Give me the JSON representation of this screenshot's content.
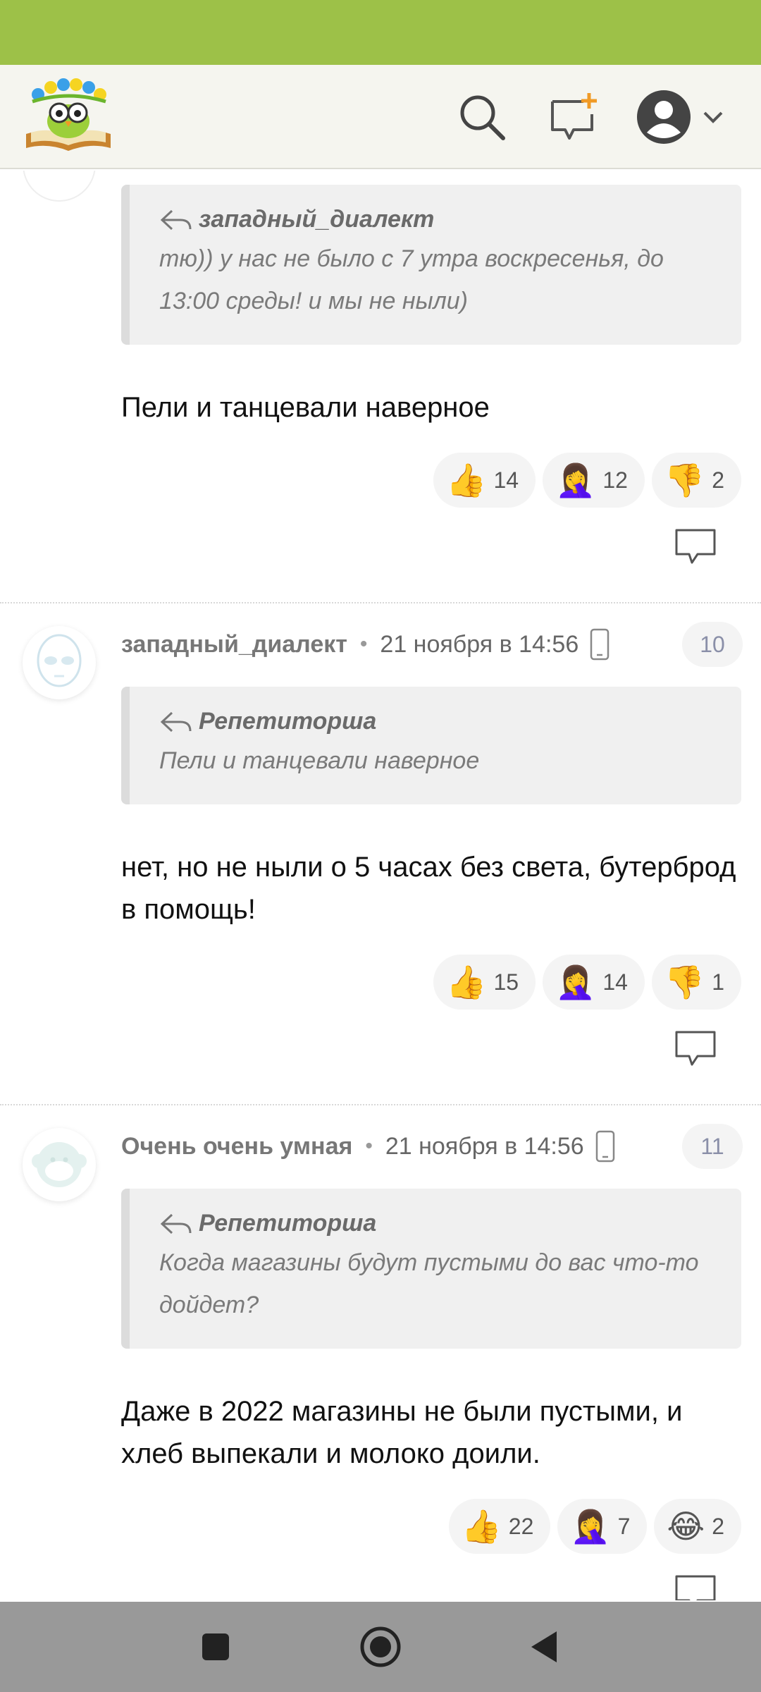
{
  "app": {
    "logo_icon": "owl-on-book-logo",
    "header_icons": [
      "search-icon",
      "compose-plus-icon",
      "user-avatar-icon",
      "chevron-down-icon"
    ],
    "colors": {
      "status_bar": "#9dc148",
      "accent": "#f09a26",
      "header_bg": "#f5f5ef",
      "nav_bar": "#999999"
    }
  },
  "comments": [
    {
      "quote": {
        "author": "западный_диалект",
        "text": "тю)) у нас не было с 7 утра воскресенья, до 13:00 среды! и мы не ныли)"
      },
      "text": "Пели и танцевали наверное",
      "reactions": [
        {
          "emoji": "👍",
          "count": "14"
        },
        {
          "emoji": "🤦‍♀️",
          "count": "12"
        },
        {
          "emoji": "👎",
          "count": "2"
        }
      ]
    },
    {
      "author": "западный_диалект",
      "time": "21 ноября в 14:56",
      "number": "10",
      "avatar_icon": "alien-avatar-icon",
      "quote": {
        "author": "Репетиторша",
        "text": "Пели и танцевали наверное"
      },
      "text": "нет, но не ныли о 5 часах без света, бутерброд в помощь!",
      "reactions": [
        {
          "emoji": "👍",
          "count": "15"
        },
        {
          "emoji": "🤦‍♀️",
          "count": "14"
        },
        {
          "emoji": "👎",
          "count": "1"
        }
      ]
    },
    {
      "author": "Очень очень умная",
      "time": "21 ноября в 14:56",
      "number": "11",
      "avatar_icon": "monkey-avatar-icon",
      "quote": {
        "author": "Репетиторша",
        "text": "Когда магазины будут пустыми до вас что-то дойдет?"
      },
      "text": "Даже в 2022 магазины не были пустыми, и хлеб выпекали и молоко доили.",
      "reactions": [
        {
          "emoji": "👍",
          "count": "22"
        },
        {
          "emoji": "🤦‍♀️",
          "count": "7"
        },
        {
          "emoji": "😂",
          "count": "2"
        }
      ]
    }
  ],
  "nav": [
    "recents-square-icon",
    "home-circle-icon",
    "back-triangle-icon"
  ]
}
